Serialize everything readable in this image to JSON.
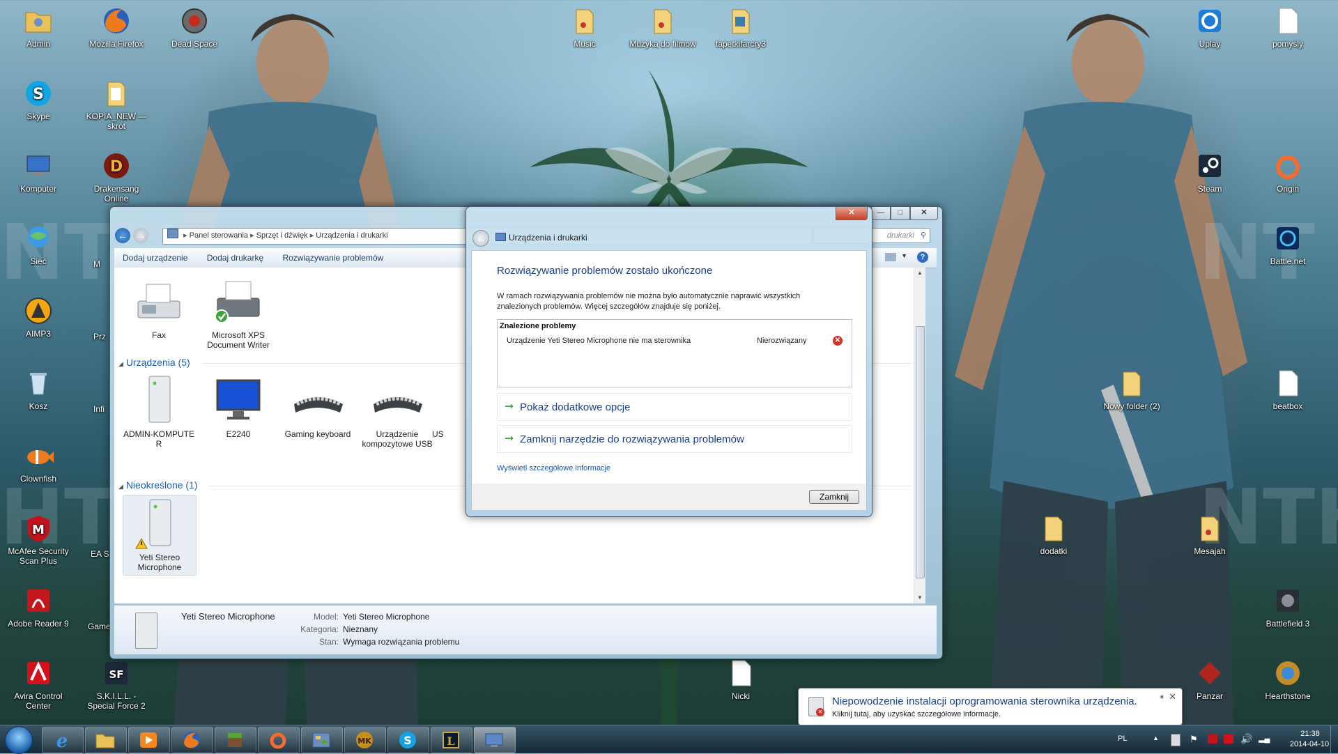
{
  "desktop": {
    "icons_left": [
      {
        "label": "Admin",
        "icon": "folder-user-icon"
      },
      {
        "label": "Mozilla Firefox",
        "icon": "firefox-icon"
      },
      {
        "label": "Dead Space",
        "icon": "dead-space-icon"
      },
      {
        "label": "Skype",
        "icon": "skype-icon"
      },
      {
        "label": "KOPIA_NEW — skrót",
        "icon": "folder-shortcut-icon"
      },
      {
        "label": "Komputer",
        "icon": "computer-icon"
      },
      {
        "label": "Drakensang Online",
        "icon": "drakensang-icon"
      },
      {
        "label": "Sieć",
        "icon": "network-icon"
      },
      {
        "label": "AIMP3",
        "icon": "aimp-icon"
      },
      {
        "label": "Kosz",
        "icon": "recycle-bin-icon"
      },
      {
        "label": "Clownfish",
        "icon": "clownfish-icon"
      },
      {
        "label": "McAfee Security Scan Plus",
        "icon": "mcafee-icon"
      },
      {
        "label": "Adobe Reader 9",
        "icon": "adobe-reader-icon"
      },
      {
        "label": "Avira Control Center",
        "icon": "avira-icon"
      },
      {
        "label": "S.K.I.L.L. - Special Force 2",
        "icon": "skill-icon"
      }
    ],
    "partial_labels": [
      "M",
      "Prz",
      "Infi",
      "EA S",
      "Game"
    ],
    "icons_top": [
      {
        "label": "Music",
        "icon": "music-folder-icon"
      },
      {
        "label": "Muzyka do filmow",
        "icon": "music-folder-icon"
      },
      {
        "label": "tapetkifarcry3",
        "icon": "image-folder-icon"
      }
    ],
    "icons_right": [
      {
        "label": "Uplay",
        "icon": "uplay-icon"
      },
      {
        "label": "pomysly",
        "icon": "text-file-icon"
      },
      {
        "label": "Steam",
        "icon": "steam-icon"
      },
      {
        "label": "Origin",
        "icon": "origin-icon"
      },
      {
        "label": "Battle.net",
        "icon": "battlenet-icon"
      },
      {
        "label": "Nowy folder (2)",
        "icon": "folder-icon"
      },
      {
        "label": "beatbox",
        "icon": "text-file-icon"
      },
      {
        "label": "dodatki",
        "icon": "folder-icon"
      },
      {
        "label": "Mesajah",
        "icon": "music-folder-icon"
      },
      {
        "label": "Battlefield 3",
        "icon": "battlefield-icon"
      },
      {
        "label": "Panzar",
        "icon": "panzar-icon"
      },
      {
        "label": "Hearthstone",
        "icon": "hearthstone-icon"
      },
      {
        "label": "Nicki",
        "icon": "text-file-icon"
      }
    ]
  },
  "explorer": {
    "breadcrumb": [
      "Panel sterowania",
      "Sprzęt i dźwięk",
      "Urządzenia i drukarki"
    ],
    "search_placeholder": "drukarki",
    "toolbar": [
      "Dodaj urządzenie",
      "Dodaj drukarkę",
      "Rozwiązywanie problemów"
    ],
    "printers": [
      {
        "label": "Fax",
        "icon": "fax-icon"
      },
      {
        "label": "Microsoft XPS Document Writer",
        "icon": "printer-icon"
      }
    ],
    "devices_group": "Urządzenia (5)",
    "devices": [
      {
        "label": "ADMIN-KOMPUTER",
        "icon": "pc-tower-icon"
      },
      {
        "label": "E2240",
        "icon": "monitor-icon"
      },
      {
        "label": "Gaming keyboard",
        "icon": "keyboard-icon"
      },
      {
        "label": "Urządzenie kompozytowe USB",
        "icon": "keyboard-icon"
      },
      {
        "label": "US",
        "icon": "usb-warning-icon"
      }
    ],
    "unspecified_group": "Nieokreślone (1)",
    "unspecified": [
      {
        "label": "Yeti Stereo Microphone",
        "icon": "device-warning-icon"
      }
    ],
    "details": {
      "name": "Yeti Stereo Microphone",
      "model_label": "Model:",
      "model": "Yeti Stereo Microphone",
      "category_label": "Kategoria:",
      "category": "Nieznany",
      "status_label": "Stan:",
      "status": "Wymaga rozwiązania problemu"
    }
  },
  "troubleshooter": {
    "title": "Urządzenia i drukarki",
    "heading": "Rozwiązywanie problemów zostało ukończone",
    "description": "W ramach rozwiązywania problemów nie można było automatycznie naprawić wszystkich znalezionych problemów. Więcej szczegółów znajduje się poniżej.",
    "found_header": "Znalezione problemy",
    "problem": "Urządzenie Yeti Stereo Microphone nie ma sterownika",
    "problem_status": "Nierozwiązany",
    "option1": "Pokaż dodatkowe opcje",
    "option2": "Zamknij narzędzie do rozwiązywania problemów",
    "details_link": "Wyświetl szczegółowe informacje",
    "close_button": "Zamknij"
  },
  "notification": {
    "title": "Niepowodzenie instalacji oprogramowania sterownika urządzenia.",
    "body": "Kliknij tutaj, aby uzyskać szczegółowe informacje."
  },
  "taskbar": {
    "language": "PL",
    "time": "21:38",
    "date": "2014-04-10",
    "pinned": [
      "start-orb-icon",
      "internet-explorer-icon",
      "explorer-icon",
      "media-player-icon",
      "firefox-icon",
      "minecraft-icon",
      "origin-icon",
      "control-panel-icon",
      "mk-icon",
      "skype-icon",
      "league-icon",
      "devices-window-icon"
    ]
  },
  "colors": {
    "accent": "#1d5fb0",
    "link": "#1a56b4",
    "error": "#d0342c"
  }
}
